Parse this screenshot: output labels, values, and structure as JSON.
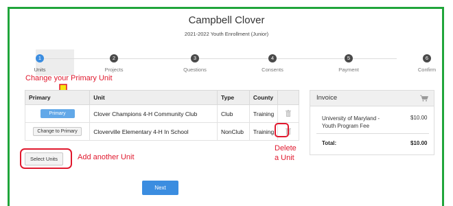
{
  "header": {
    "title": "Campbell Clover",
    "subtitle": "2021-2022 Youth Enrollment (Junior)"
  },
  "steps": [
    {
      "num": "1",
      "label": "Units",
      "active": true
    },
    {
      "num": "2",
      "label": "Projects",
      "active": false
    },
    {
      "num": "3",
      "label": "Questions",
      "active": false
    },
    {
      "num": "4",
      "label": "Consents",
      "active": false
    },
    {
      "num": "5",
      "label": "Payment",
      "active": false
    },
    {
      "num": "6",
      "label": "Confirm",
      "active": false
    }
  ],
  "annotations": {
    "change_primary": "Change your Primary Unit",
    "add_unit": "Add another Unit",
    "delete_line1": "Delete",
    "delete_line2": "a Unit"
  },
  "table": {
    "headers": {
      "primary": "Primary",
      "unit": "Unit",
      "type": "Type",
      "county": "County"
    },
    "rows": [
      {
        "button": "Primary",
        "unit": "Clover Champions 4-H Community Club",
        "type": "Club",
        "county": "Training"
      },
      {
        "button": "Change to Primary",
        "unit": "Cloverville Elementary 4-H In School",
        "type": "NonClub",
        "county": "Training"
      }
    ]
  },
  "buttons": {
    "select_units": "Select Units",
    "next": "Next"
  },
  "invoice": {
    "title": "Invoice",
    "item_line1": "University of Maryland -",
    "item_line2": "Youth Program Fee",
    "item_price": "$10.00",
    "total_label": "Total:",
    "total_value": "$10.00"
  },
  "colors": {
    "frame": "#1fa53a",
    "accent": "#3b8de0",
    "annotation": "#e0182d",
    "arrow": "#f5e60f"
  },
  "icons": {
    "trash": "trash-icon",
    "cart": "shopping-cart-icon",
    "arrow": "arrow-down-icon"
  }
}
